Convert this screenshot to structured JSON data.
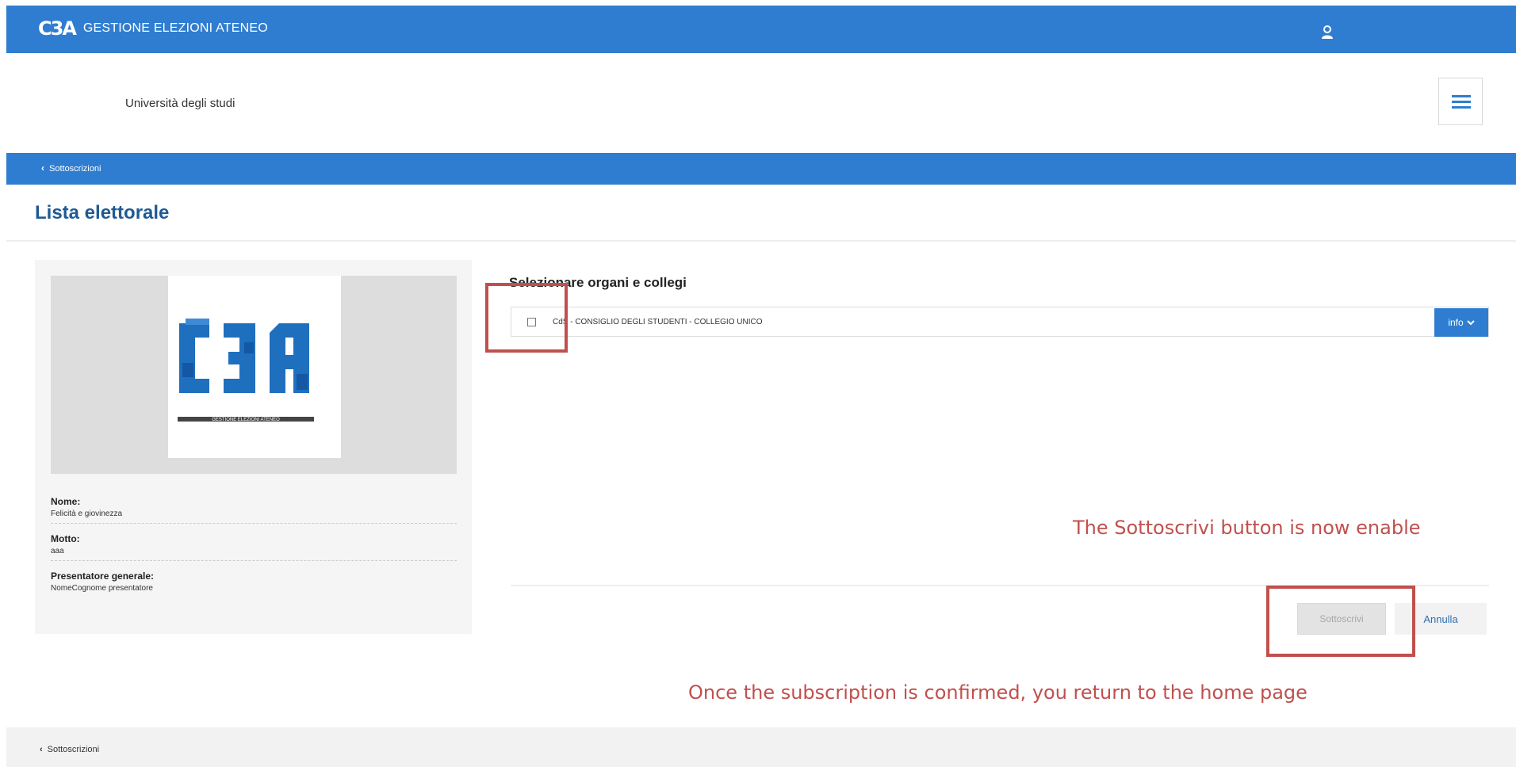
{
  "app": {
    "logo_text": "C3A",
    "title": "GESTIONE ELEZIONI ATENEO"
  },
  "header": {
    "university": "Università degli studi",
    "menu_icon": "hamburger-icon",
    "user_icon": "user-icon"
  },
  "breadcrumb": {
    "label": "Sottoscrizioni"
  },
  "page": {
    "title": "Lista elettorale"
  },
  "list_card": {
    "logo_tagline": "GESTIONE ELEZIONI ATENEO",
    "fields": [
      {
        "label": "Nome:",
        "value": "Felicità e giovinezza"
      },
      {
        "label": "Motto:",
        "value": "aaa"
      },
      {
        "label": "Presentatore generale:",
        "value": "NomeCognome presentatore"
      }
    ]
  },
  "selection": {
    "title": "Selezionare organi e collegi",
    "organ_label": "CdS - CONSIGLIO DEGLI STUDENTI - COLLEGIO UNICO",
    "organ_checked": false,
    "info_label": "info"
  },
  "buttons": {
    "subscribe": "Sottoscrivi",
    "cancel": "Annulla"
  },
  "annotations": {
    "enabled_note": "The Sottoscrivi button is now enable",
    "return_note": "Once the subscription is confirmed, you return to the home page",
    "color": "#c0504d"
  },
  "footer": {
    "breadcrumb": "Sottoscrizioni"
  },
  "colors": {
    "primary": "#2f7dd0",
    "title": "#1f5a94"
  }
}
